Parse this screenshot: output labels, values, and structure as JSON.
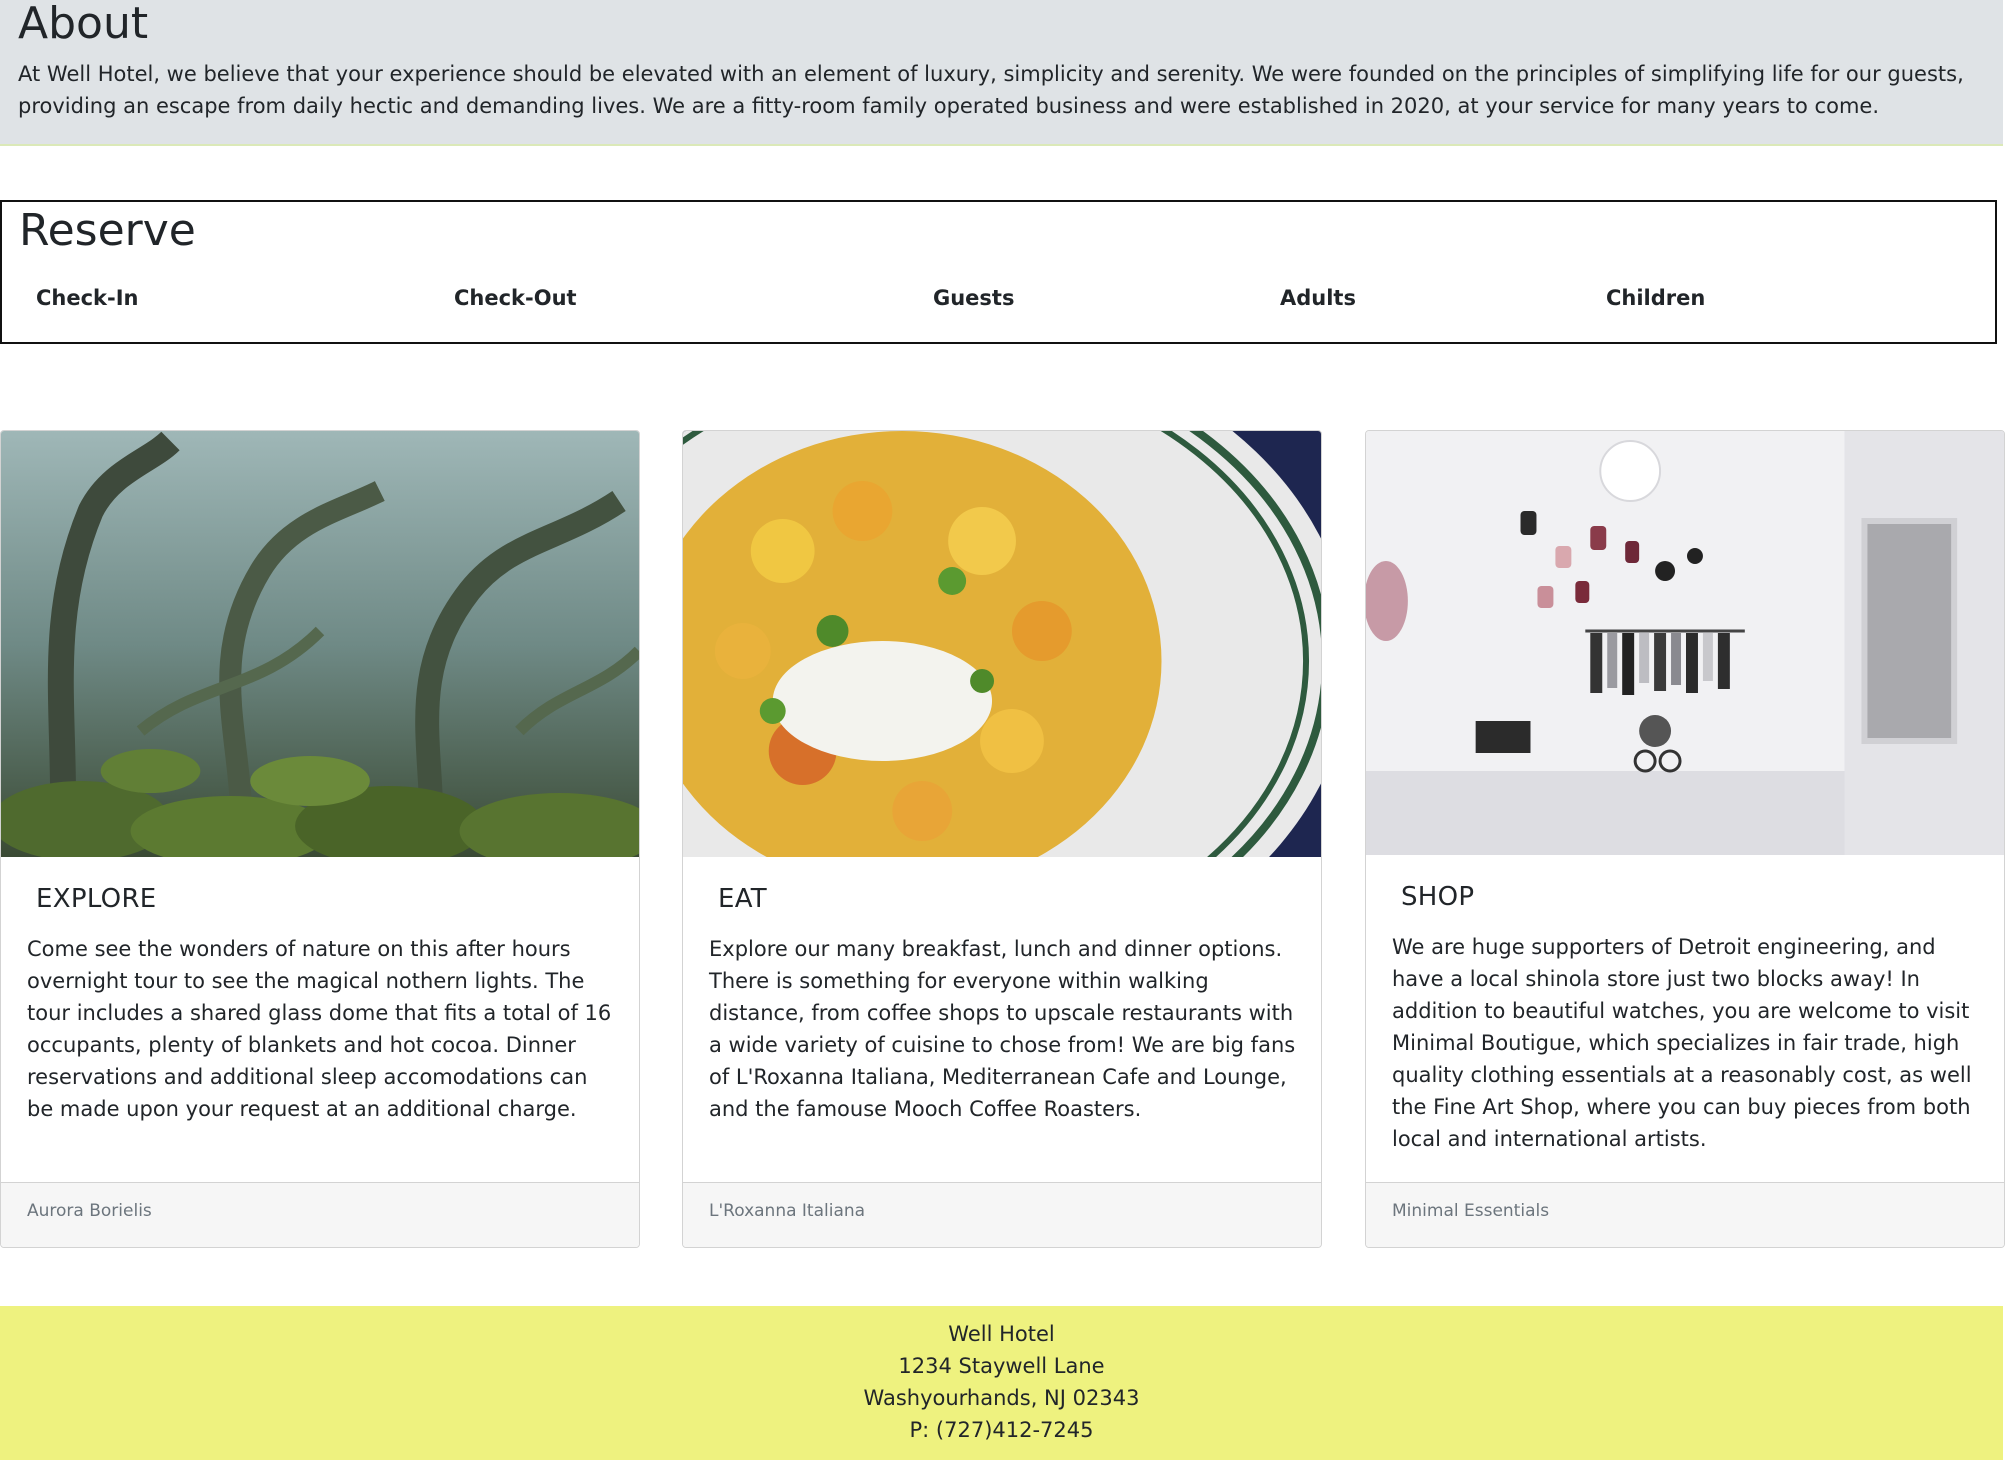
{
  "about": {
    "heading": "About",
    "text": "At Well Hotel, we believe that your experience should be elevated with an element of luxury, simplicity and serenity. We were founded on the principles of simplifying life for our guests, providing an escape from daily hectic and demanding lives. We are a fitty-room family operated business and were established in 2020, at your service for many years to come."
  },
  "reserve": {
    "heading": "Reserve",
    "fields": [
      "Check-In",
      "Check-Out",
      "Guests",
      "Adults",
      "Children"
    ]
  },
  "cards": [
    {
      "title": "EXPLORE",
      "text": "Come see the wonders of nature on this after hours overnight tour to see the magical nothern lights. The tour includes a shared glass dome that fits a total of 16 occupants, plenty of blankets and hot cocoa. Dinner reservations and additional sleep accomodations can be made upon your request at an additional charge.",
      "footer": "Aurora Borielis",
      "image": "misty-forest-photo"
    },
    {
      "title": "EAT",
      "text": "Explore our many breakfast, lunch and dinner options. There is something for everyone within walking distance, from coffee shops to upscale restaurants with a wide variety of cuisine to chose from! We are big fans of L'Roxanna Italiana, Mediterranean Cafe and Lounge, and the famouse Mooch Coffee Roasters.",
      "footer": "L'Roxanna Italiana",
      "image": "pasta-dish-photo"
    },
    {
      "title": "SHOP",
      "text": "We are huge supporters of Detroit engineering, and have a local shinola store just two blocks away! In addition to beautiful watches, you are welcome to visit Minimal Boutigue, which specializes in fair trade, high quality clothing essentials at a reasonably cost, as well the Fine Art Shop, where you can buy pieces from both local and international artists.",
      "footer": "Minimal Essentials",
      "image": "boutique-interior-photo"
    }
  ],
  "footer": {
    "name": "Well Hotel",
    "street": "1234 Staywell Lane",
    "city": "Washyourhands, NJ 02343",
    "phone": "P: (727)412-7245"
  }
}
